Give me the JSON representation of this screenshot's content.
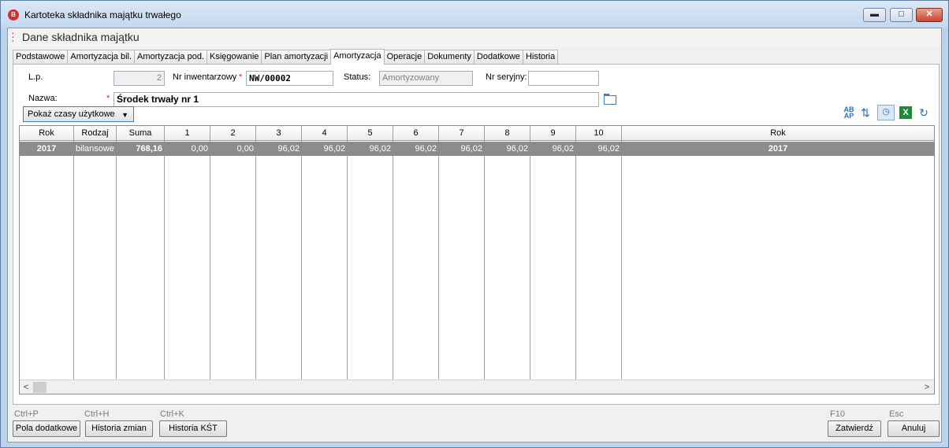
{
  "window": {
    "title": "Kartoteka składnika majątku trwałego",
    "icon_letter": "B",
    "header_title": "Dane składnika majątku"
  },
  "tabs": [
    {
      "label": "Podstawowe"
    },
    {
      "label": "Amortyzacja bil."
    },
    {
      "label": "Amortyzacja pod."
    },
    {
      "label": "Księgowanie"
    },
    {
      "label": "Plan amortyzacji"
    },
    {
      "label": "Amortyzacja",
      "active": true
    },
    {
      "label": "Operacje"
    },
    {
      "label": "Dokumenty"
    },
    {
      "label": "Dodatkowe"
    },
    {
      "label": "Historia"
    }
  ],
  "form": {
    "lp_label": "L.p.",
    "lp_value": "2",
    "nr_label": "Nr inwentarzowy",
    "nr_value": "NW/00002",
    "status_label": "Status:",
    "status_value": "Amortyzowany",
    "serial_label": "Nr seryjny:",
    "serial_value": "",
    "name_label": "Nazwa:",
    "name_value": "Środek trwały nr 1",
    "required_mark": "*"
  },
  "toolbar": {
    "view_select": "Pokaż czasy użytkowe",
    "ab_label": "AB",
    "ap_label": "AP"
  },
  "grid": {
    "columns": [
      "Rok",
      "Rodzaj",
      "Suma",
      "1",
      "2",
      "3",
      "4",
      "5",
      "6",
      "7",
      "8",
      "9",
      "10",
      "Rok"
    ],
    "rows": [
      [
        "2017",
        "bilansowe",
        "768,16",
        "0,00",
        "0,00",
        "96,02",
        "96,02",
        "96,02",
        "96,02",
        "96,02",
        "96,02",
        "96,02",
        "96,02",
        "2017"
      ]
    ]
  },
  "footer": {
    "shortcut_pola": "Ctrl+P",
    "pola_label": "Pola dodatkowe",
    "shortcut_historia": "Ctrl+H",
    "historia_label": "Historia zmian",
    "shortcut_kst": "Ctrl+K",
    "kst_label": "Historia KŚT",
    "shortcut_ok": "F10",
    "ok_label": "Zatwierdź",
    "shortcut_cancel": "Esc",
    "cancel_label": "Anuluj"
  },
  "colors": {
    "selected_row": "#8c8c8c",
    "accent": "#3c7fb1",
    "required": "#dd2222"
  }
}
